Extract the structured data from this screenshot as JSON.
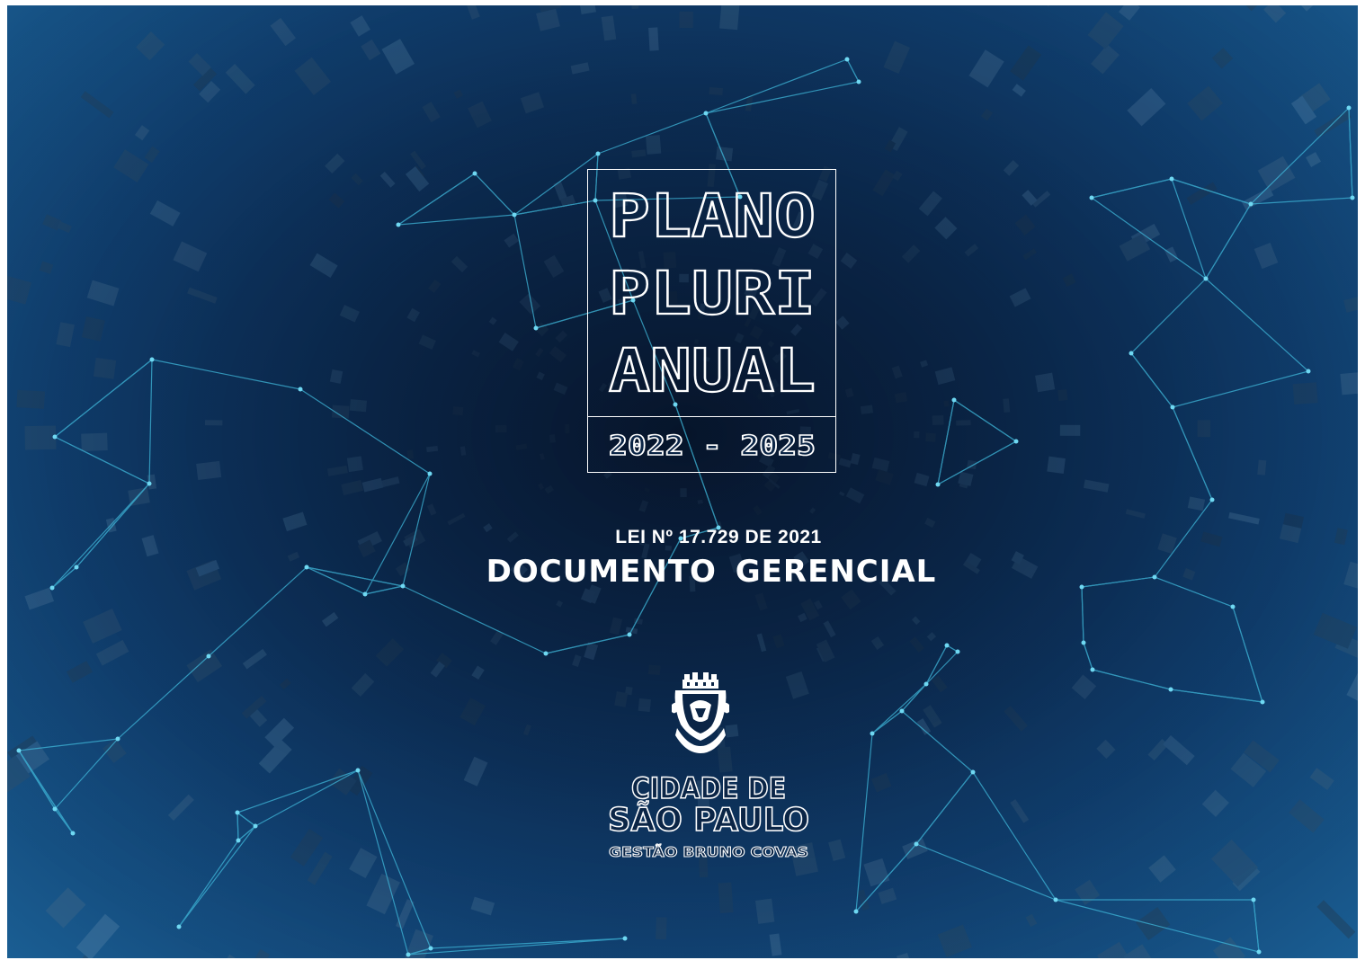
{
  "cover": {
    "title_lines": [
      "PLANO",
      "PLURI",
      "ANUAL"
    ],
    "years": "2022 - 2025",
    "law": "LEI Nº 17.729 DE 2021",
    "document_type": "DOCUMENTO GERENCIAL"
  },
  "logo": {
    "city_line1": "CIDADE DE",
    "city_line2": "SÃO PAULO",
    "administration": "GESTÃO BRUNO COVAS",
    "icon": "city-coat-of-arms-icon"
  },
  "colors": {
    "background_dark": "#0b2546",
    "background_light": "#1a5e93",
    "network_lines": "#3fb6d8",
    "text": "#ffffff"
  }
}
